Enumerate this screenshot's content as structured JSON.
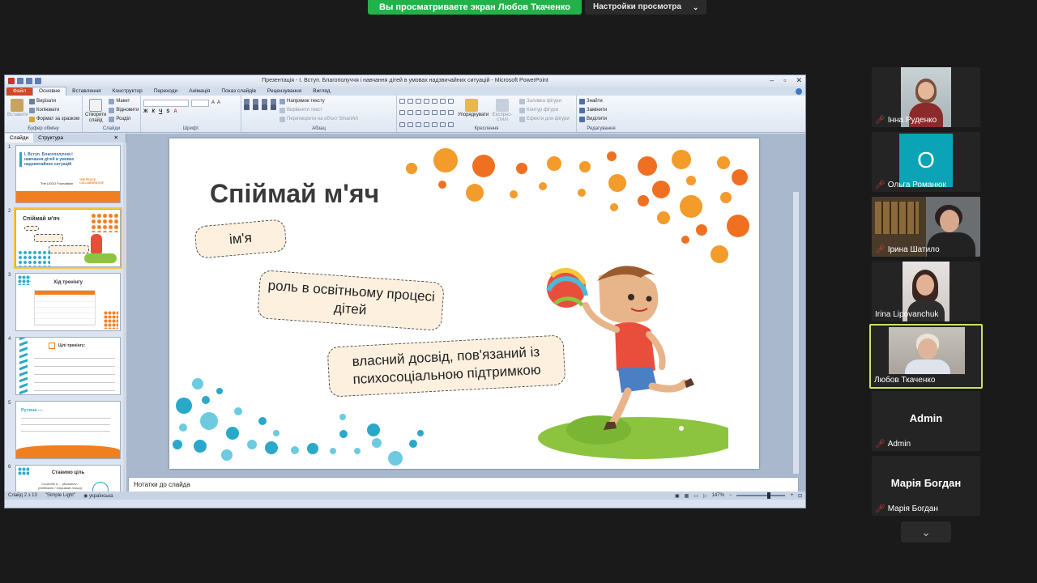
{
  "share": {
    "viewing": "Вы просматриваете экран Любов Ткаченко",
    "settings": "Настройки просмотра"
  },
  "ppt": {
    "title": "Презентація - І. Вступ. Благополуччя і навчання дітей в умовах надзвичайних ситуацій - Microsoft PowerPoint",
    "tabs": [
      "Файл",
      "Основне",
      "Вставлення",
      "Конструктор",
      "Переходи",
      "Анімація",
      "Показ слайдів",
      "Рецензування",
      "Вигляд"
    ],
    "ribbon": {
      "clipboard": {
        "paste": "Вставити",
        "cut": "Вирізати",
        "copy": "Копіювати",
        "format": "Формат за зразком",
        "label": "Буфер обміну"
      },
      "slides": {
        "new": "Створити слайд",
        "layout": "Макет",
        "reset": "Відновити",
        "section": "Розділ",
        "label": "Слайди"
      },
      "font": {
        "label": "Шрифт"
      },
      "paragraph": {
        "dir": "Напрямок тексту",
        "align": "Вирівняти текст",
        "smartart": "Перетворити на об'єкт SmartArt",
        "label": "Абзац"
      },
      "drawing": {
        "arrange": "Упорядкувати",
        "styles": "Експрес-стилі",
        "fill": "Заливка фігури",
        "outline": "Контур фігури",
        "effects": "Ефекти для фігури",
        "label": "Креслення"
      },
      "editing": {
        "find": "Знайти",
        "replace": "Замінити",
        "select": "Виділити",
        "label": "Редагування"
      }
    },
    "panel_tabs": [
      "Слайди",
      "Структура"
    ],
    "thumbs": [
      {
        "num": "1",
        "title": "І. Вступ. Благополуччя і навчання дітей в умовах надзвичайних ситуацій",
        "logo1": "The LEGO Foundation",
        "logo2": "THE PEACE COLLABORATIVE"
      },
      {
        "num": "2",
        "title": "Спіймай м'яч"
      },
      {
        "num": "3",
        "title": "Хід тренінгу"
      },
      {
        "num": "4",
        "title": "Цілі тренінгу:"
      },
      {
        "num": "5",
        "title": "Рутина —"
      },
      {
        "num": "6",
        "title": "Ставимо ціль",
        "sub": "Сьогодні я ... (дізнаюся / усвідомлю / отримаю тощо)"
      }
    ],
    "notes": "Нотатки до слайда",
    "status": {
      "slide": "Слайд 2 з 13",
      "theme": "\"Simple Light\"",
      "lang": "українська",
      "zoom": "147%"
    }
  },
  "slide": {
    "title": "Спіймай м'яч",
    "pill1": "ім'я",
    "pill2": "роль в освітньому процесі дітей",
    "pill3": "власний досвід, пов'язаний із психосоціальною підтримкою"
  },
  "participants": [
    {
      "name": "Інна Руденко",
      "muted": true
    },
    {
      "name": "Ольга Романюк",
      "muted": true,
      "initial": "О"
    },
    {
      "name": "Ірина Шатило",
      "muted": true
    },
    {
      "name": "Irina Lipovanchuk",
      "muted": false
    },
    {
      "name": "Любов Ткаченко",
      "muted": false
    },
    {
      "name": "Admin",
      "muted": true,
      "big": "Admin"
    },
    {
      "name": "Марія Богдан",
      "muted": true,
      "big": "Марія Богдан"
    }
  ],
  "colors": {
    "orange": "#f07f22",
    "teal": "#2aa8c9",
    "green": "#8cc43f"
  }
}
